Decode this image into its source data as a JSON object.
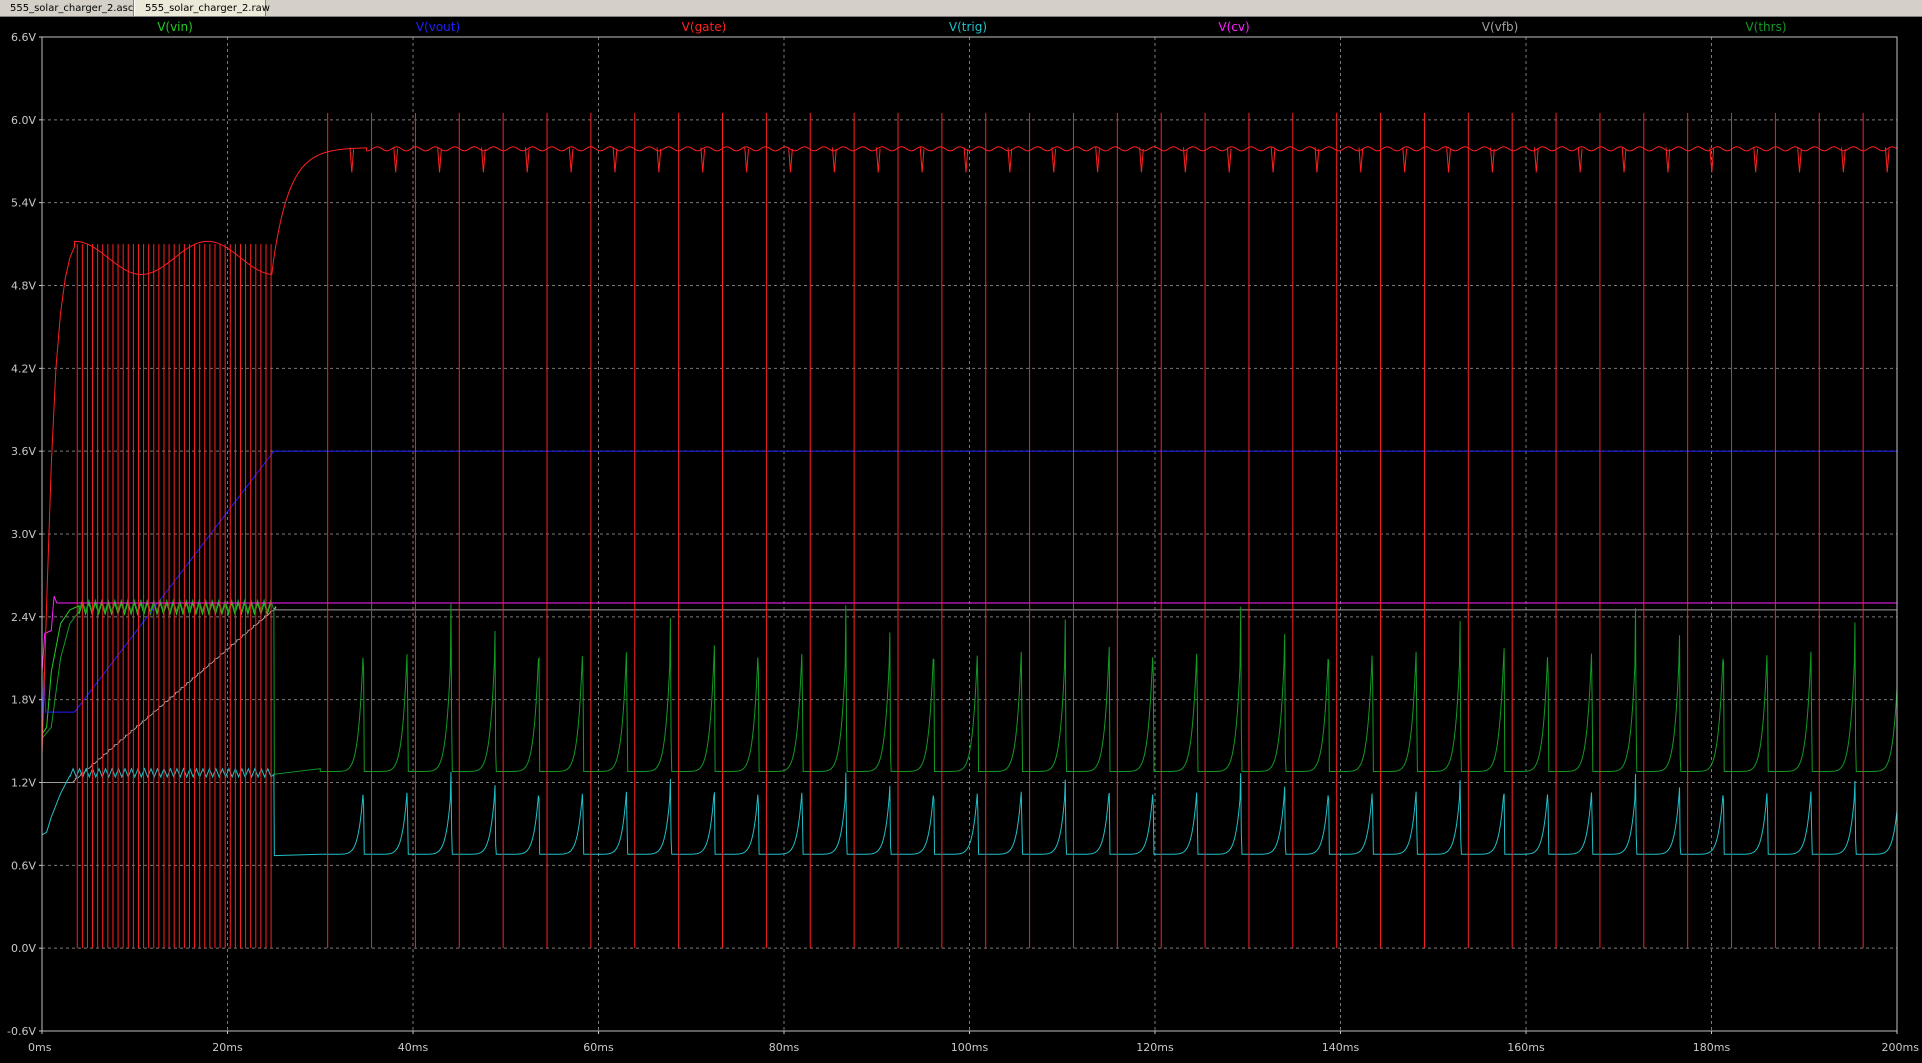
{
  "tabs": [
    {
      "label": "555_solar_charger_2.asc",
      "icon": "schematic-icon"
    },
    {
      "label": "555_solar_charger_2.raw",
      "icon": "waveform-icon"
    }
  ],
  "colors": {
    "background": "#000000",
    "grid": "#7a7a7a",
    "axis_text": "#c8c8c8",
    "vin": "#22cc22",
    "vout": "#2020ff",
    "gate": "#ff2020",
    "trig": "#20c0c8",
    "cv": "#ff20ff",
    "vfb": "#a0a0a0",
    "thrs": "#129a24"
  },
  "chart_data": {
    "type": "line",
    "title": "",
    "xlabel": "",
    "ylabel": "",
    "xlim": [
      0,
      200
    ],
    "ylim": [
      -0.6,
      6.6
    ],
    "x_ticks": [
      "0ms",
      "20ms",
      "40ms",
      "60ms",
      "80ms",
      "100ms",
      "120ms",
      "140ms",
      "160ms",
      "180ms",
      "200ms"
    ],
    "y_ticks": [
      "-0.6V",
      "0.0V",
      "0.6V",
      "1.2V",
      "1.8V",
      "2.4V",
      "3.0V",
      "3.6V",
      "4.2V",
      "4.8V",
      "5.4V",
      "6.0V",
      "6.6V"
    ],
    "grid": true,
    "legend": "top",
    "series": [
      {
        "name": "V(vin)",
        "key": "vin",
        "description_values": {
          "startup_level": 1.6,
          "steady": 2.5
        }
      },
      {
        "name": "V(vout)",
        "key": "vout",
        "description_values": {
          "initial": 1.7,
          "ramp_end_ms": 25,
          "steady": 3.6
        }
      },
      {
        "name": "V(gate)",
        "key": "gate",
        "description_values": {
          "phase1_end_ms": 25,
          "phase1_high": 5.1,
          "phase2_high": 5.8,
          "pulse_low": 0.0,
          "pulse_peak": 6.05,
          "phase2_pulse_period_ms": 4.7
        }
      },
      {
        "name": "V(trig)",
        "key": "trig",
        "description_values": {
          "initial": 0.82,
          "phase1_level": 1.27,
          "phase2_base": 0.68,
          "phase2_peak": 1.28
        }
      },
      {
        "name": "V(cv)",
        "key": "cv",
        "description_values": {
          "initial": 2.3,
          "steady": 2.5
        }
      },
      {
        "name": "V(vfb)",
        "key": "vfb",
        "description_values": {
          "start": 1.2,
          "end_ms": 25,
          "end": 2.45
        }
      },
      {
        "name": "V(thrs)",
        "key": "thrs",
        "description_values": {
          "phase1_level": 2.45,
          "phase2_base": 1.28,
          "phase2_peak": 2.5
        }
      }
    ]
  }
}
